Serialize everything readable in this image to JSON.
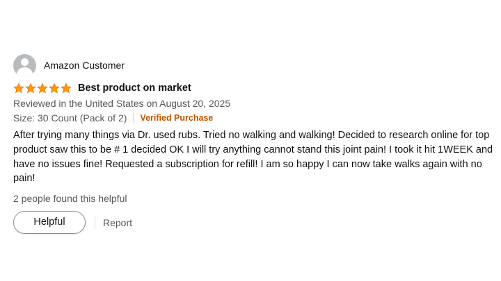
{
  "review": {
    "profile_name": "Amazon Customer",
    "rating": 5,
    "rating_max": 5,
    "star_color": "#ff9900",
    "title": "Best product on market",
    "date_text": "Reviewed in the United States on August 20, 2025",
    "variant": "Size: 30 Count (Pack of 2)",
    "verified_label": "Verified Purchase",
    "verified_color": "#c45500",
    "body": "After trying many things via Dr. used rubs. Tried no walking and walking! Decided to research online for top product saw this to be # 1 decided OK I will try anything cannot stand this joint pain! I took it hit 1WEEK and have no issues fine! Requested a subscription for refill! I am so happy I can now take walks again with no pain!",
    "helpful_count_text": "2 people found this helpful",
    "helpful_button_label": "Helpful",
    "report_label": "Report",
    "avatar_icon": "user-avatar-icon",
    "star_icon": "star-icon"
  }
}
